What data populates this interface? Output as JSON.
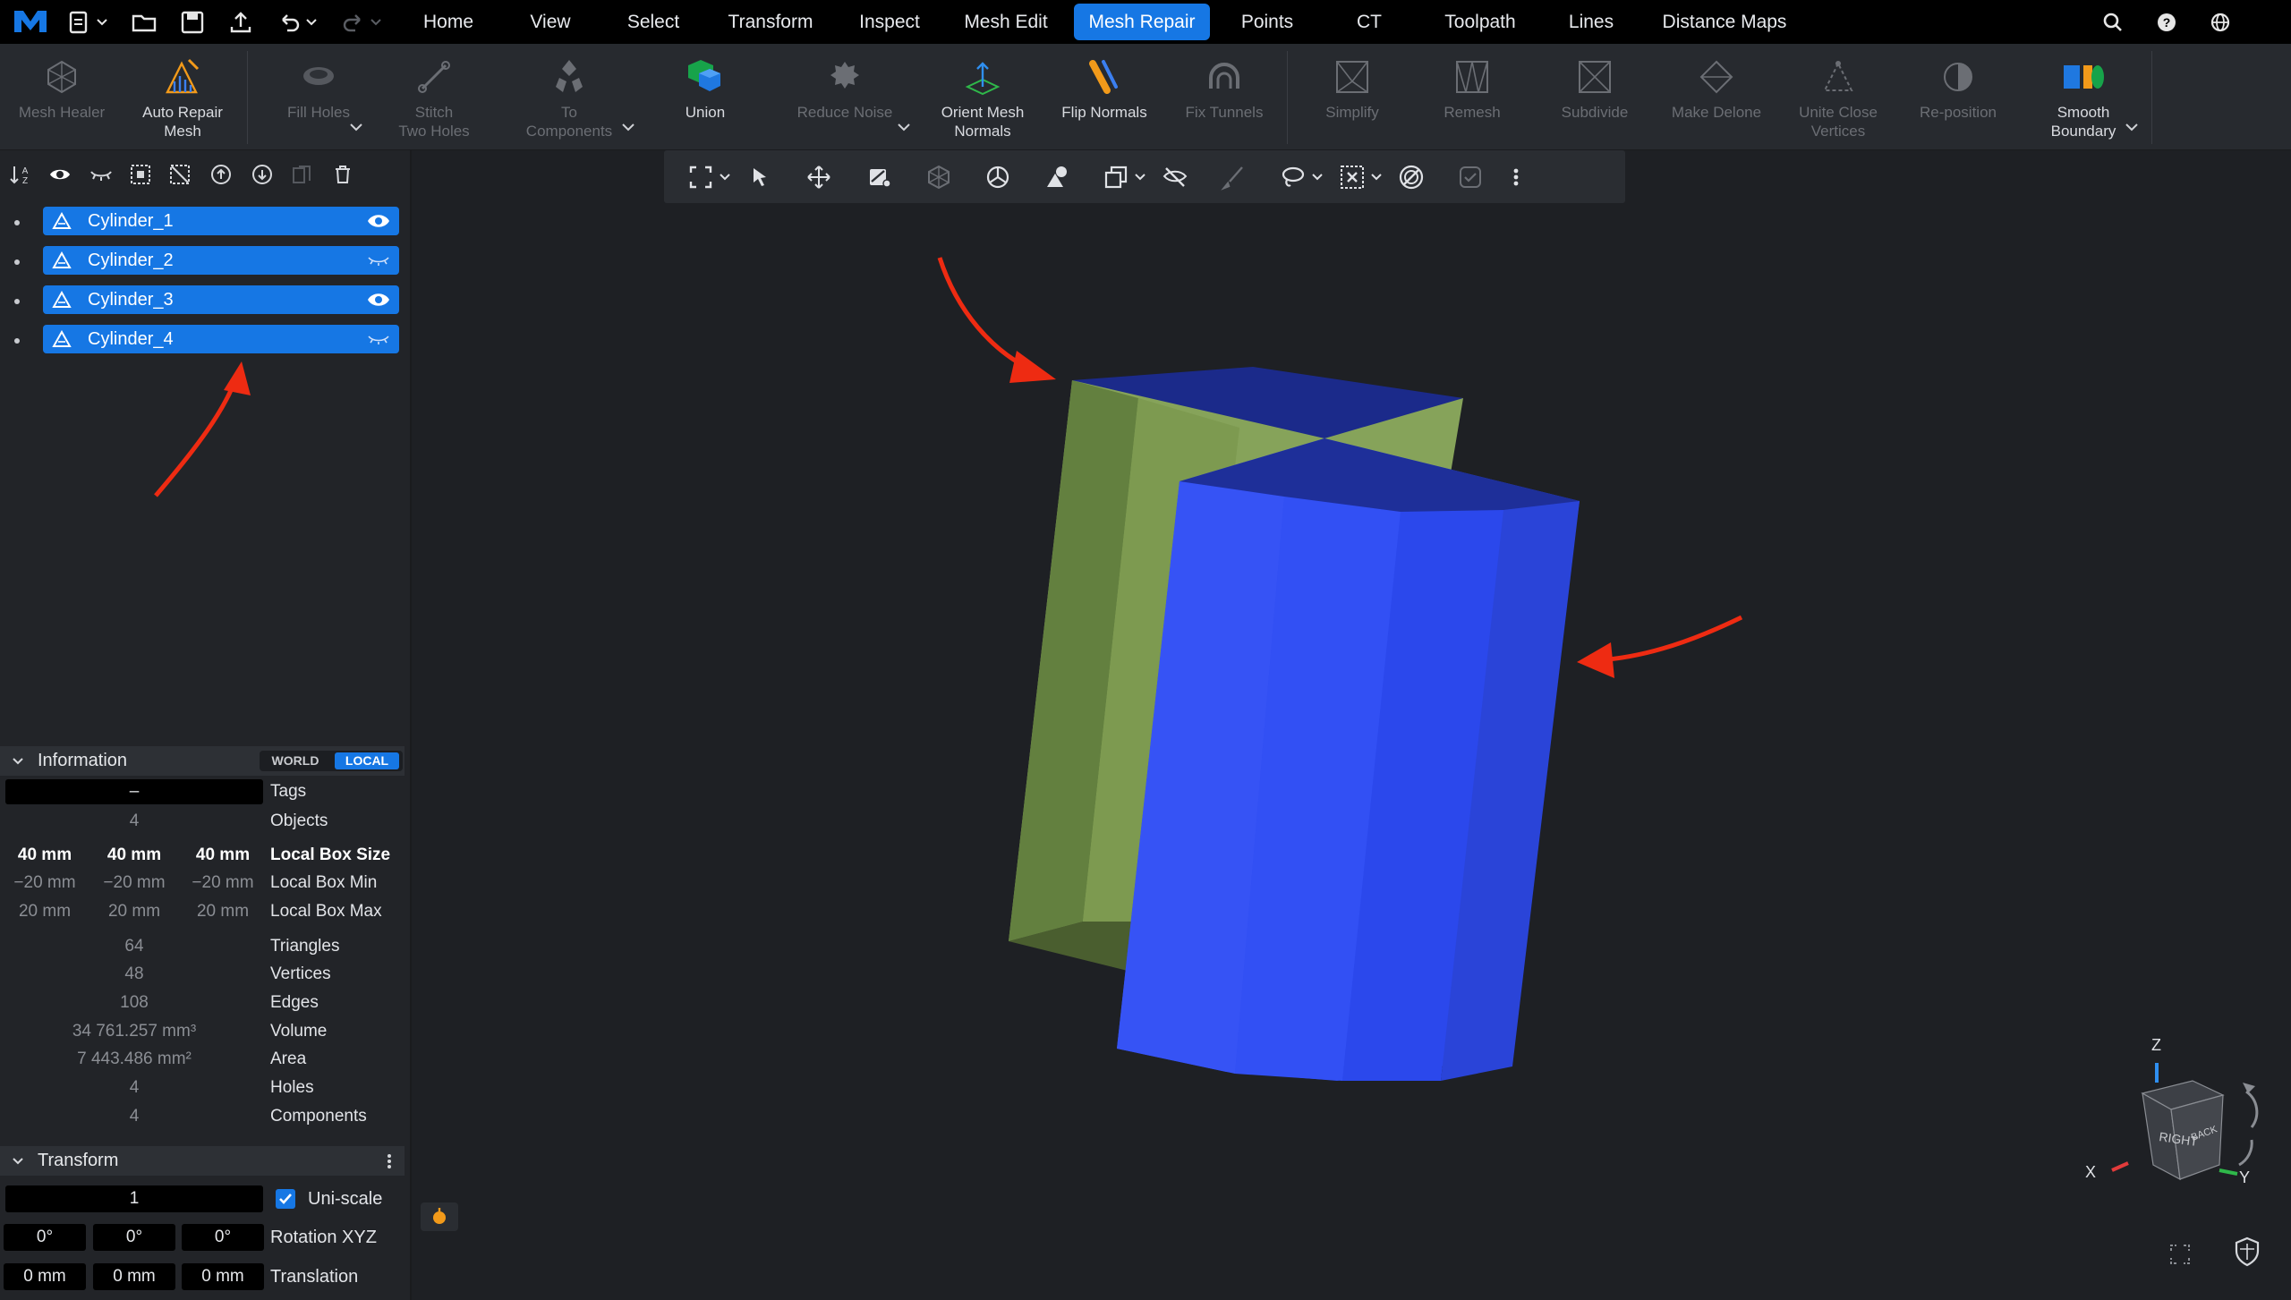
{
  "menubar": {
    "tabs": [
      "Home",
      "View",
      "Select",
      "Transform",
      "Inspect",
      "Mesh Edit",
      "Mesh Repair",
      "Points",
      "CT",
      "Toolpath",
      "Lines",
      "Distance Maps"
    ],
    "active_tab": "Mesh Repair"
  },
  "ribbon": {
    "mesh_healer": "Mesh Healer",
    "auto_repair_1": "Auto Repair",
    "auto_repair_2": "Mesh",
    "fill_holes": "Fill Holes",
    "stitch_1": "Stitch",
    "stitch_2": "Two Holes",
    "to_components_1": "To",
    "to_components_2": "Components",
    "union": "Union",
    "reduce_noise": "Reduce Noise",
    "orient_1": "Orient Mesh",
    "orient_2": "Normals",
    "flip_normals": "Flip Normals",
    "fix_tunnels": "Fix Tunnels",
    "simplify": "Simplify",
    "remesh": "Remesh",
    "subdivide": "Subdivide",
    "make_delone": "Make Delone",
    "unite_1": "Unite Close",
    "unite_2": "Vertices",
    "reposition": "Re-position",
    "smooth_1": "Smooth",
    "smooth_2": "Boundary"
  },
  "objects": [
    {
      "name": "Cylinder_1",
      "visible": true
    },
    {
      "name": "Cylinder_2",
      "visible": false
    },
    {
      "name": "Cylinder_3",
      "visible": true
    },
    {
      "name": "Cylinder_4",
      "visible": false
    }
  ],
  "information": {
    "title": "Information",
    "world": "WORLD",
    "local": "LOCAL",
    "tags_value": "–",
    "tags_label": "Tags",
    "objects_value": "4",
    "objects_label": "Objects",
    "box_size": [
      "40 mm",
      "40 mm",
      "40 mm"
    ],
    "box_size_label": "Local Box Size",
    "box_min": [
      "−20 mm",
      "−20 mm",
      "−20 mm"
    ],
    "box_min_label": "Local Box Min",
    "box_max": [
      "20 mm",
      "20 mm",
      "20 mm"
    ],
    "box_max_label": "Local Box Max",
    "triangles": "64",
    "triangles_label": "Triangles",
    "vertices": "48",
    "vertices_label": "Vertices",
    "edges": "108",
    "edges_label": "Edges",
    "volume": "34 761.257 mm³",
    "volume_label": "Volume",
    "area": "7 443.486 mm²",
    "area_label": "Area",
    "holes": "4",
    "holes_label": "Holes",
    "components": "4",
    "components_label": "Components"
  },
  "transform": {
    "title": "Transform",
    "scale_value": "1",
    "uniscale_label": "Uni-scale",
    "uniscale_checked": true,
    "rotation": [
      "0°",
      "0°",
      "0°"
    ],
    "rotation_label": "Rotation XYZ",
    "translation": [
      "0 mm",
      "0 mm",
      "0 mm"
    ],
    "translation_label": "Translation"
  },
  "viewcube": {
    "z": "Z",
    "x": "X",
    "y": "Y",
    "right": "RIGHT",
    "back": "BACK"
  },
  "colors": {
    "accent": "#1677e4",
    "annotation_arrow": "#ee2b12",
    "front_mesh": "#2f4ef2",
    "back_mesh": "#86a35a"
  }
}
